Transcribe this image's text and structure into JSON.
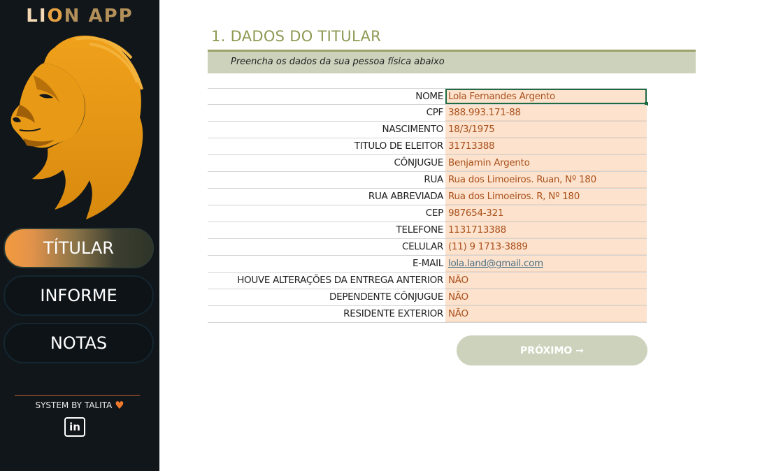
{
  "app": {
    "title_part1": "LI",
    "title_part2": "O",
    "title_part3": "N APP"
  },
  "sidebar": {
    "nav": [
      {
        "label": "TÍTULAR",
        "active": true
      },
      {
        "label": "INFORME",
        "active": false
      },
      {
        "label": "NOTAS",
        "active": false
      }
    ],
    "footer_text": "SYSTEM BY TALITA",
    "heart_icon": "♥",
    "linkedin_label": "in"
  },
  "main": {
    "section_title": "1. DADOS DO TITULAR",
    "subtitle": "Preencha os dados da sua pessoa física abaixo",
    "fields": [
      {
        "label": "NOME",
        "value": "Lola Fernandes Argento"
      },
      {
        "label": "CPF",
        "value": "388.993.171-88"
      },
      {
        "label": "NASCIMENTO",
        "value": "18/3/1975"
      },
      {
        "label": "TITULO DE ELEITOR",
        "value": "31713388"
      },
      {
        "label": "CÔNJUGUE",
        "value": "Benjamin Argento"
      },
      {
        "label": "RUA",
        "value": "Rua dos Limoeiros. Ruan, Nº 180"
      },
      {
        "label": "RUA ABREVIADA",
        "value": "Rua dos Limoeiros. R, Nº 180"
      },
      {
        "label": "CEP",
        "value": "987654-321"
      },
      {
        "label": "TELEFONE",
        "value": "1131713388"
      },
      {
        "label": "CELULAR",
        "value": "(11) 9 1713-3889"
      },
      {
        "label": "E-MAIL",
        "value": "lola.land@gmail.com"
      },
      {
        "label": "HOUVE ALTERAÇÕES DA ENTREGA ANTERIOR",
        "value": "NÃO"
      },
      {
        "label": "DEPENDENTE CÔNJUGUE",
        "value": "NÃO"
      },
      {
        "label": "RESIDENTE EXTERIOR",
        "value": "NÃO"
      }
    ],
    "next_button": "PRÓXIMO ➞"
  },
  "colors": {
    "sidebar_bg": "#11161b",
    "accent_olive": "#8d9a52",
    "field_bg": "#fde3cd",
    "field_text": "#a9501c",
    "button_bg": "#cdd2bc"
  }
}
